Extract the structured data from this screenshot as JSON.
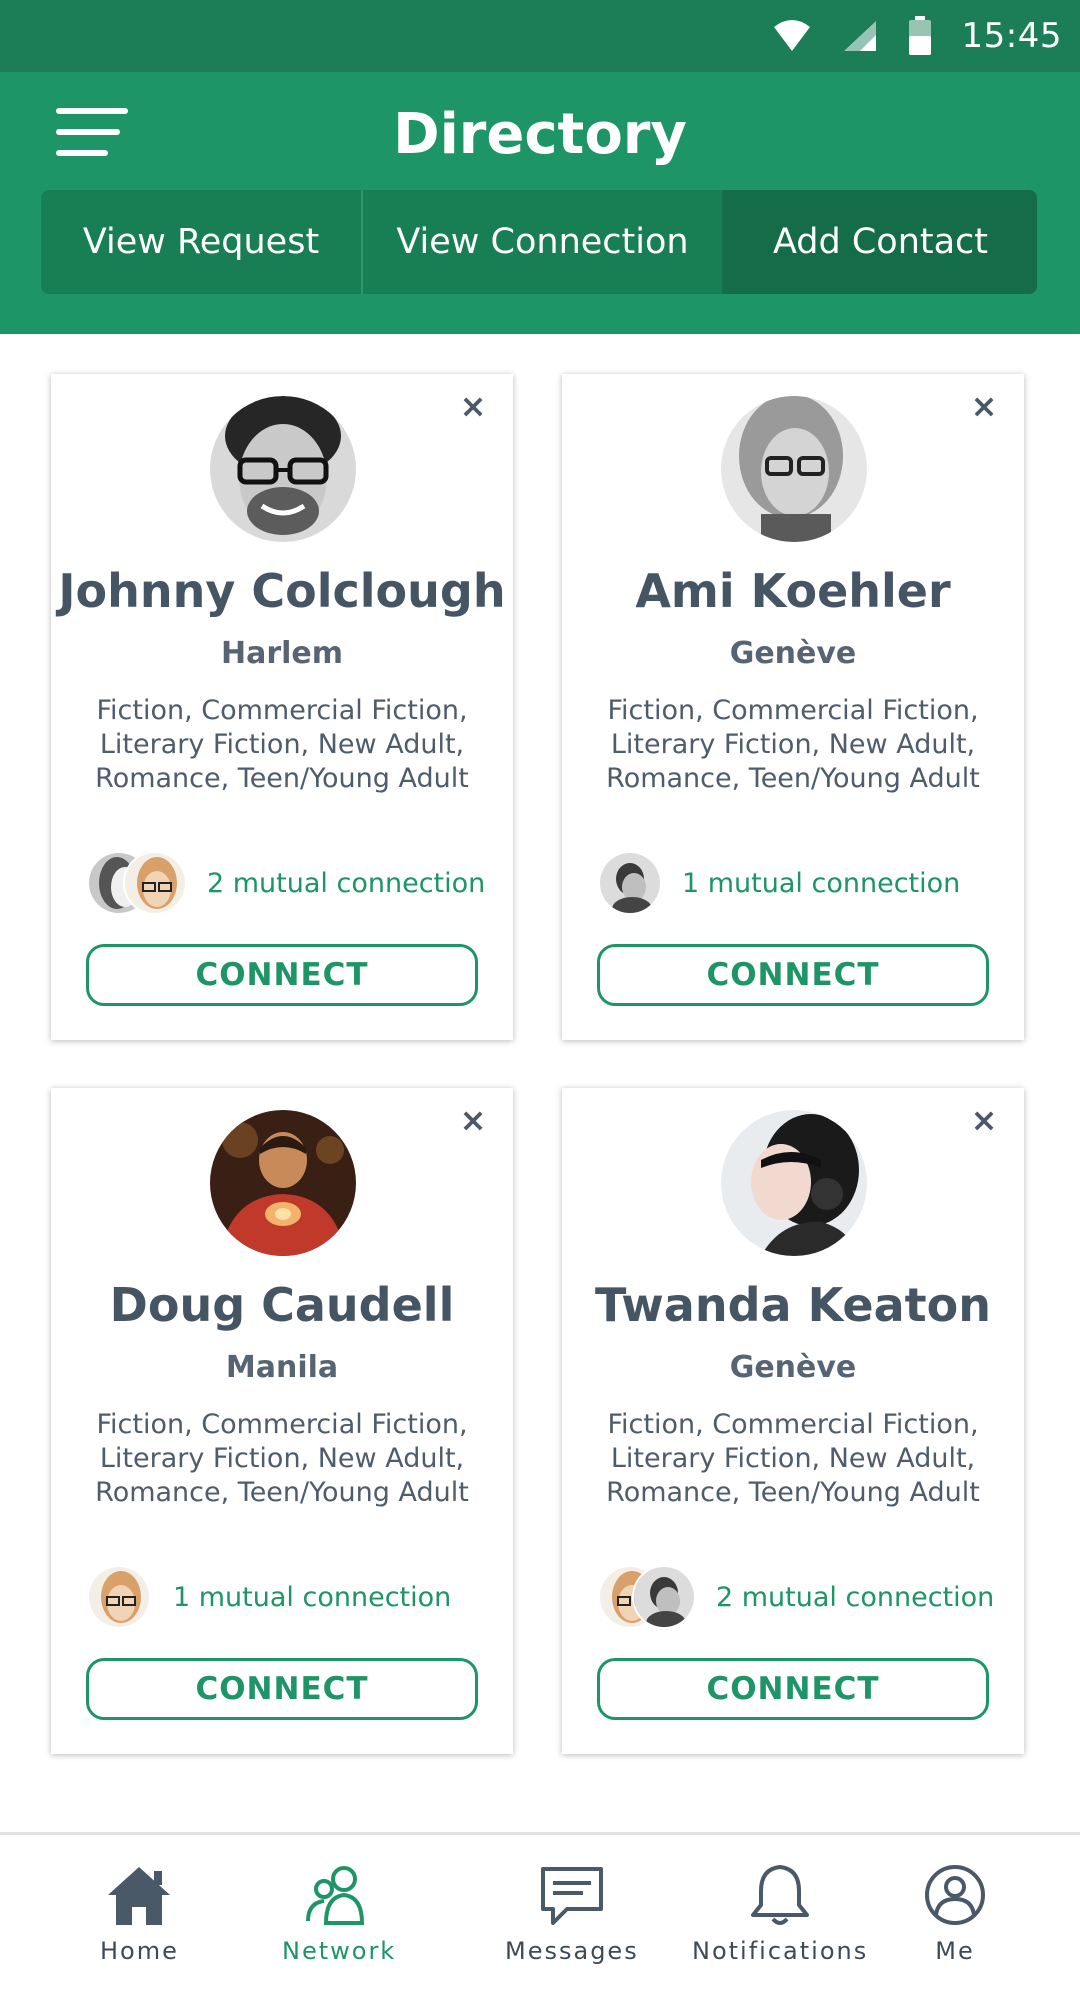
{
  "status_bar": {
    "time": "15:45"
  },
  "header": {
    "title": "Directory",
    "tabs": [
      {
        "label": "View Request"
      },
      {
        "label": "View Connection"
      },
      {
        "label": "Add Contact"
      }
    ]
  },
  "cards": [
    {
      "name": "Johnny Colclough",
      "location": "Harlem",
      "genres": "Fiction, Commercial Fiction, Literary Fiction, New Adult, Romance, Teen/Young Adult",
      "mutual": "2 mutual connection",
      "button": "CONNECT",
      "close": "×"
    },
    {
      "name": "Ami Koehler",
      "location": "Genève",
      "genres": "Fiction, Commercial Fiction, Literary Fiction, New Adult, Romance, Teen/Young Adult",
      "mutual": "1 mutual connection",
      "button": "CONNECT",
      "close": "×"
    },
    {
      "name": "Doug Caudell",
      "location": "Manila",
      "genres": "Fiction, Commercial Fiction, Literary Fiction, New Adult, Romance, Teen/Young Adult",
      "mutual": "1 mutual connection",
      "button": "CONNECT",
      "close": "×"
    },
    {
      "name": "Twanda Keaton",
      "location": "Genève",
      "genres": "Fiction, Commercial Fiction, Literary Fiction, New Adult, Romance, Teen/Young Adult",
      "mutual": "2 mutual connection",
      "button": "CONNECT",
      "close": "×"
    }
  ],
  "bottom_nav": [
    {
      "label": "Home",
      "icon": "home-icon"
    },
    {
      "label": "Network",
      "icon": "network-icon",
      "active": true
    },
    {
      "label": "Messages",
      "icon": "messages-icon"
    },
    {
      "label": "Notifications",
      "icon": "bell-icon"
    },
    {
      "label": "Me",
      "icon": "profile-icon"
    }
  ],
  "colors": {
    "status_bar": "#1b7e57",
    "header": "#1d9566",
    "accent": "#1d9566",
    "text": "#465564"
  }
}
